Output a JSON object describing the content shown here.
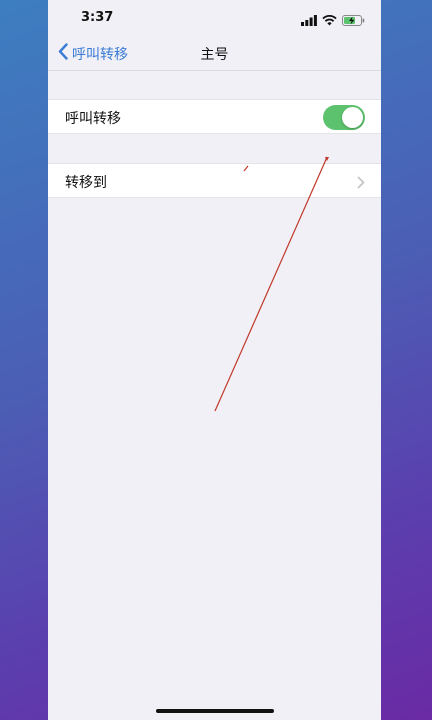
{
  "status_bar": {
    "time": "3:37",
    "icons": [
      "cellular-signal-icon",
      "wifi-icon",
      "battery-charging-icon"
    ]
  },
  "nav_bar": {
    "back_label": "呼叫转移",
    "title": "主号"
  },
  "settings": {
    "call_forwarding": {
      "label": "呼叫转移",
      "toggle_on": true
    },
    "forward_to": {
      "label": "转移到"
    }
  },
  "colors": {
    "accent": "#3a7bd5",
    "toggle_on": "#5cc26d",
    "background": "#f1f0f6",
    "annotation": "#c0392b"
  }
}
